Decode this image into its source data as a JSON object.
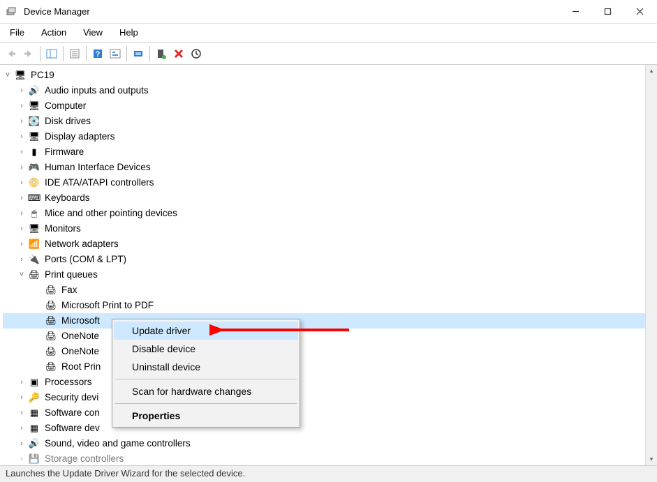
{
  "window": {
    "title": "Device Manager"
  },
  "menus": [
    "File",
    "Action",
    "View",
    "Help"
  ],
  "tree": {
    "root": "PC19",
    "categories": [
      {
        "icon": "audio",
        "label": "Audio inputs and outputs",
        "expand": ">",
        "truncated": false
      },
      {
        "icon": "computer",
        "label": "Computer",
        "expand": ">",
        "truncated": false
      },
      {
        "icon": "disk",
        "label": "Disk drives",
        "expand": ">",
        "truncated": false
      },
      {
        "icon": "display",
        "label": "Display adapters",
        "expand": ">",
        "truncated": false
      },
      {
        "icon": "firmware",
        "label": "Firmware",
        "expand": ">",
        "truncated": false
      },
      {
        "icon": "hid",
        "label": "Human Interface Devices",
        "expand": ">",
        "truncated": false
      },
      {
        "icon": "ide",
        "label": "IDE ATA/ATAPI controllers",
        "expand": ">",
        "truncated": false
      },
      {
        "icon": "keyboard",
        "label": "Keyboards",
        "expand": ">",
        "truncated": false
      },
      {
        "icon": "mouse",
        "label": "Mice and other pointing devices",
        "expand": ">",
        "truncated": false
      },
      {
        "icon": "monitor",
        "label": "Monitors",
        "expand": ">",
        "truncated": false
      },
      {
        "icon": "network",
        "label": "Network adapters",
        "expand": ">",
        "truncated": false
      },
      {
        "icon": "port",
        "label": "Ports (COM & LPT)",
        "expand": ">",
        "truncated": false
      },
      {
        "icon": "printq",
        "label": "Print queues",
        "expand": "v",
        "truncated": false,
        "children": [
          {
            "icon": "printer",
            "label": "Fax"
          },
          {
            "icon": "printer",
            "label": "Microsoft Print to PDF"
          },
          {
            "icon": "printer",
            "label": "Microsoft XPS Document Writer",
            "selected": true,
            "truncated": "Microsoft"
          },
          {
            "icon": "printer",
            "label": "OneNote",
            "truncated": "OneNote"
          },
          {
            "icon": "printer",
            "label": "OneNote",
            "truncated": "OneNote"
          },
          {
            "icon": "printer",
            "label": "Root Print",
            "truncated": "Root Prin"
          }
        ]
      },
      {
        "icon": "processor",
        "label": "Processors",
        "expand": ">",
        "truncated": false
      },
      {
        "icon": "security",
        "label": "Security devi",
        "expand": ">",
        "truncated": true
      },
      {
        "icon": "software",
        "label": "Software con",
        "expand": ">",
        "truncated": true
      },
      {
        "icon": "software",
        "label": "Software dev",
        "expand": ">",
        "truncated": true
      },
      {
        "icon": "sound",
        "label": "Sound, video and game controllers",
        "expand": ">",
        "truncated": false
      },
      {
        "icon": "storage",
        "label": "Storage controllers",
        "expand": ">",
        "truncated": true,
        "faded": true
      }
    ]
  },
  "context_menu": {
    "items": [
      {
        "label": "Update driver",
        "highlight": true
      },
      {
        "label": "Disable device"
      },
      {
        "label": "Uninstall device"
      },
      {
        "sep": true
      },
      {
        "label": "Scan for hardware changes"
      },
      {
        "sep": true
      },
      {
        "label": "Properties",
        "bold": true
      }
    ]
  },
  "statusbar": "Launches the Update Driver Wizard for the selected device.",
  "icon_glyphs": {
    "audio": "🔊",
    "computer": "🖥",
    "disk": "💽",
    "display": "🖥",
    "firmware": "▮",
    "hid": "🎮",
    "ide": "📀",
    "keyboard": "⌨",
    "mouse": "🖱",
    "monitor": "🖥",
    "network": "📶",
    "port": "🔌",
    "printq": "🖨",
    "printer": "🖨",
    "processor": "▣",
    "security": "🔑",
    "software": "▦",
    "sound": "🔊",
    "storage": "💾",
    "pc": "🖥",
    "app": "🖥"
  }
}
